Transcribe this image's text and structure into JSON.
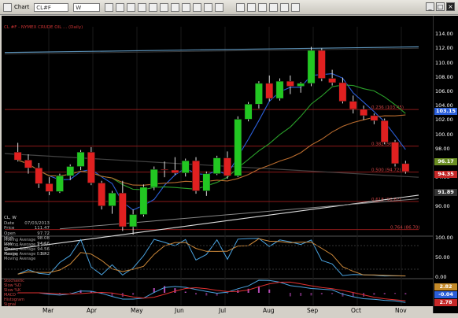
{
  "toolbar": {
    "chart_button": "Chart",
    "symbol": "CL#F",
    "interval": "W"
  },
  "header_legend": "CL #F - NYMEX CRUDE OIL ... (Daily)",
  "price_axis": {
    "ticks": [
      "114.00",
      "112.00",
      "110.00",
      "108.00",
      "106.00",
      "104.00",
      "102.00",
      "100.00",
      "98.00",
      "96.00",
      "94.00",
      "92.00",
      "90.00"
    ],
    "tags": {
      "level_1": {
        "text": "103.15",
        "color": "#2b5fd9"
      },
      "level_2": {
        "text": "96.17",
        "color": "#6b8e23"
      },
      "level_3": {
        "text": "94.35",
        "color": "#c62828"
      },
      "level_4": {
        "text": "91.89",
        "color": "#333333"
      }
    }
  },
  "fib_labels": [
    "0.236 (103.45)",
    "0.382 (98.34)",
    "0.500 (94.72)",
    "0.618 (90.62)",
    "0.764 (86.70)"
  ],
  "x_axis": {
    "labels": [
      "Mar",
      "Apr",
      "May",
      "Jun",
      "Jul",
      "Aug",
      "Sep",
      "Oct",
      "Nov"
    ]
  },
  "info": {
    "title": "CL, W",
    "rows": [
      {
        "k": "Date",
        "v": "07/03/2013"
      },
      {
        "k": "Price",
        "v": "111.47"
      },
      {
        "k": "Open",
        "v": "97.72"
      },
      {
        "k": "High",
        "v": "98.08"
      },
      {
        "k": "Low",
        "v": "94.66"
      },
      {
        "k": "Close",
        "v": "94.56"
      },
      {
        "k": "Range",
        "v": "3.42"
      }
    ]
  },
  "subpanel_1": {
    "legends": [
      "Moving Average",
      "Moving Average 1.50",
      "Moving Average",
      "Moving Average 0.00",
      "Moving Average"
    ],
    "ticks": [
      "100.00",
      "50.00",
      "0.00"
    ]
  },
  "subpanel_2": {
    "legends": [
      "Stochastic",
      "Slow %D",
      "Slow %K",
      "MACD",
      "Histogram",
      "Signal"
    ],
    "tags": {
      "a": "2.82",
      "b": "-0.04",
      "c": "2.78"
    }
  },
  "chart_data": {
    "type": "candlestick",
    "series": [
      {
        "name": "CL#F",
        "ohlc": [
          [
            97.5,
            98.8,
            96.2,
            96.4
          ],
          [
            96.4,
            97.2,
            94.5,
            95.3
          ],
          [
            95.3,
            96.0,
            92.5,
            93.1
          ],
          [
            93.1,
            94.0,
            91.5,
            92.0
          ],
          [
            92.0,
            94.5,
            91.8,
            94.2
          ],
          [
            94.2,
            95.8,
            93.6,
            95.5
          ],
          [
            95.5,
            97.8,
            95.0,
            97.5
          ],
          [
            97.5,
            98.2,
            92.9,
            93.2
          ],
          [
            93.2,
            93.5,
            89.5,
            90.0
          ],
          [
            90.0,
            92.1,
            88.9,
            91.8
          ],
          [
            91.8,
            93.5,
            86.5,
            87.1
          ],
          [
            87.1,
            89.5,
            86.0,
            88.8
          ],
          [
            88.8,
            93.0,
            88.5,
            92.6
          ],
          [
            92.6,
            95.5,
            92.2,
            95.1
          ],
          [
            95.1,
            96.2,
            94.0,
            95.0
          ],
          [
            95.0,
            96.8,
            94.3,
            94.6
          ],
          [
            94.6,
            96.6,
            94.1,
            96.3
          ],
          [
            96.3,
            96.8,
            91.7,
            92.1
          ],
          [
            92.1,
            94.8,
            91.4,
            94.5
          ],
          [
            94.5,
            97.0,
            94.3,
            96.7
          ],
          [
            96.7,
            97.6,
            93.8,
            94.2
          ],
          [
            94.2,
            102.5,
            94.0,
            102.1
          ],
          [
            102.1,
            104.5,
            101.8,
            104.2
          ],
          [
            104.2,
            107.4,
            103.6,
            107.1
          ],
          [
            107.1,
            108.2,
            104.6,
            105.0
          ],
          [
            105.0,
            107.8,
            104.7,
            107.4
          ],
          [
            107.4,
            108.2,
            105.6,
            106.7
          ],
          [
            106.7,
            107.3,
            105.8,
            107.1
          ],
          [
            107.1,
            112.2,
            106.7,
            111.7
          ],
          [
            111.7,
            112.0,
            107.4,
            107.8
          ],
          [
            107.8,
            109.0,
            106.8,
            107.2
          ],
          [
            107.2,
            107.9,
            104.3,
            104.6
          ],
          [
            104.6,
            105.4,
            102.9,
            103.5
          ],
          [
            103.5,
            104.0,
            102.0,
            102.6
          ],
          [
            102.6,
            102.9,
            101.4,
            101.9
          ],
          [
            101.9,
            102.2,
            98.6,
            98.9
          ],
          [
            98.9,
            99.2,
            95.5,
            95.9
          ],
          [
            95.9,
            96.3,
            94.5,
            94.8
          ]
        ]
      }
    ],
    "ylim": [
      86,
      115
    ],
    "overlays": [
      "Moving Average 20",
      "Moving Average 50",
      "Moving Average 200",
      "Fibonacci retracement",
      "Trendlines"
    ]
  }
}
